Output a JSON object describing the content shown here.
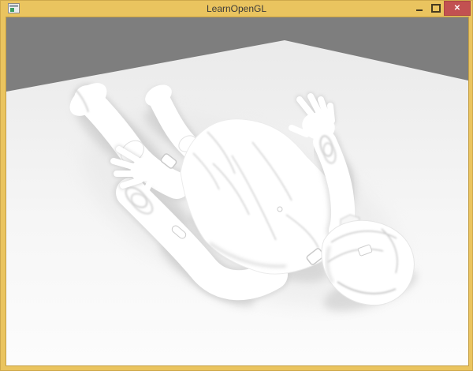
{
  "window": {
    "title": "LearnOpenGL",
    "controls": {
      "close_glyph": "✕"
    }
  },
  "colors": {
    "titlebar": "#eac45f",
    "title_text": "#3a3a3a",
    "close_button": "#c25151",
    "scene_background": "#7e7e7e",
    "floor_far": "#eaeaea",
    "floor_near": "#fcfcfc",
    "model": "#ffffff"
  },
  "scene": {
    "subject": "White 3D character model lying on its back on a floor plane, soft ambient-occlusion style render"
  }
}
